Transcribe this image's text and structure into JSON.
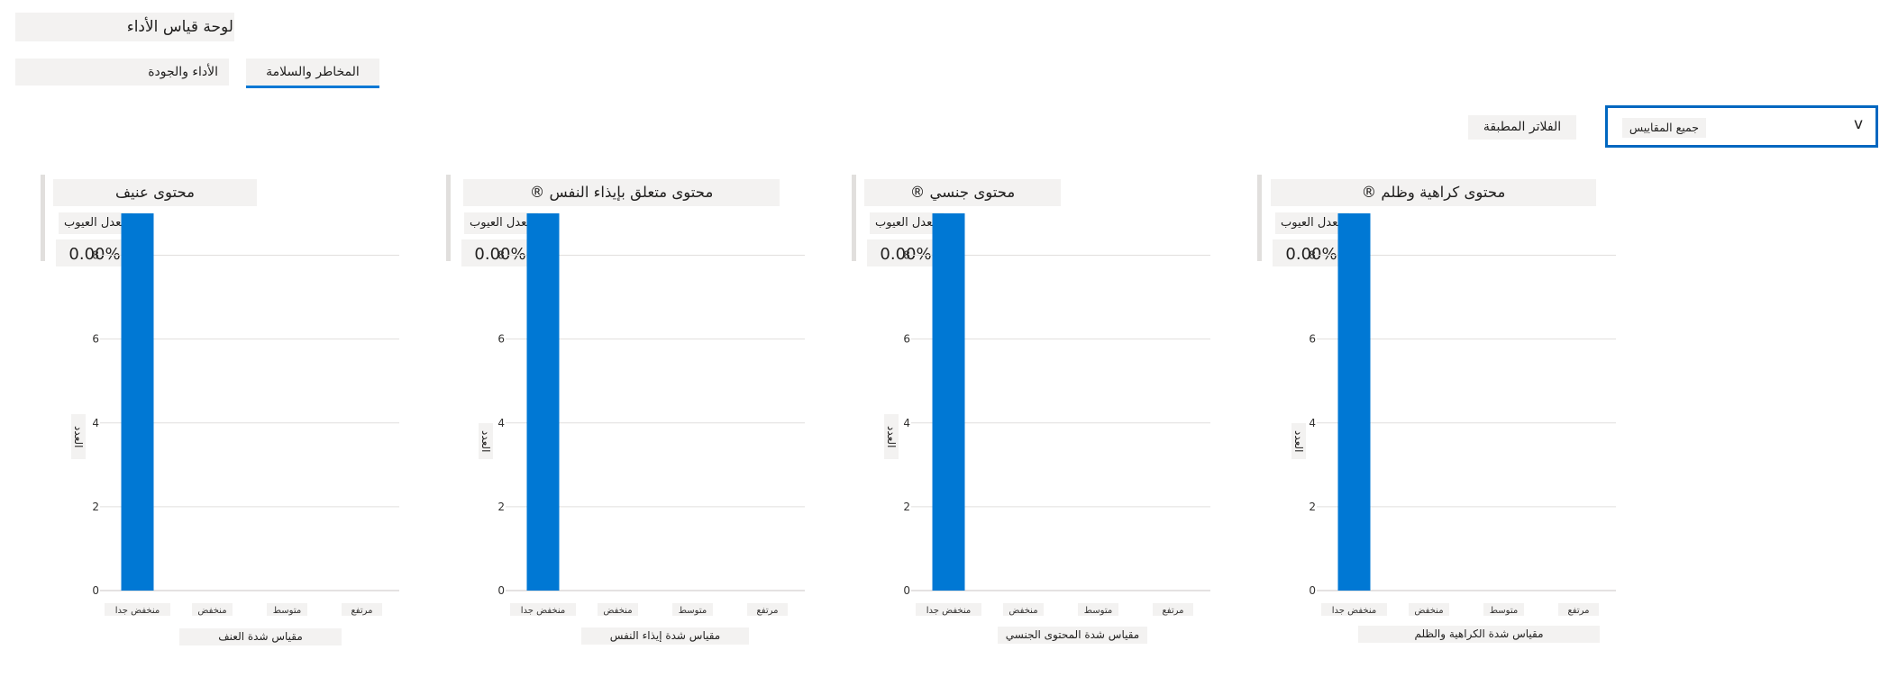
{
  "page": {
    "title": "لوحة قياس الأداء"
  },
  "tabs": [
    {
      "label": "الأداء والجودة",
      "selected": false
    },
    {
      "label": "المخاطر والسلامة",
      "selected": true
    }
  ],
  "filters": {
    "label": "الفلاتر المطبقة",
    "selected_chip": "جميع المقاييس",
    "caret": "v"
  },
  "colors": {
    "accent": "#0078d4",
    "bar": "#0078d4",
    "chip_bg": "#f3f2f1"
  },
  "panels": [
    {
      "title": "محتوى عنيف",
      "metric_label": "معدل العيوب",
      "metric_value": "0.00%",
      "ylabel": "العدد",
      "xlabel": "مقياس شدة العنف",
      "ticks": [
        "0",
        "2",
        "4",
        "6",
        "8"
      ],
      "categories": [
        "منخفض جدا",
        "منخفض",
        "متوسط",
        "مرتفع"
      ],
      "values": [
        9,
        0,
        0,
        0
      ]
    },
    {
      "title": "محتوى متعلق بإيذاء النفس ®",
      "metric_label": "معدل العيوب",
      "metric_value": "0.00%",
      "ylabel": "العدد",
      "xlabel": "مقياس شدة إيذاء النفس",
      "ticks": [
        "0",
        "2",
        "4",
        "6",
        "8"
      ],
      "categories": [
        "منخفض جدا",
        "منخفض",
        "متوسط",
        "مرتفع"
      ],
      "values": [
        9,
        0,
        0,
        0
      ]
    },
    {
      "title": "محتوى جنسي ®",
      "metric_label": "معدل العيوب",
      "metric_value": "0.00%",
      "ylabel": "العدد",
      "xlabel": "مقياس شدة المحتوى الجنسي",
      "ticks": [
        "0",
        "2",
        "4",
        "6",
        "8"
      ],
      "categories": [
        "منخفض جدا",
        "منخفض",
        "متوسط",
        "مرتفع"
      ],
      "values": [
        9,
        0,
        0,
        0
      ]
    },
    {
      "title": "محتوى كراهية وظلم ®",
      "metric_label": "معدل العيوب",
      "metric_value": "0.00%",
      "ylabel": "العدد",
      "xlabel": "مقياس شدة الكراهية والظلم",
      "ticks": [
        "0",
        "2",
        "4",
        "6",
        "8"
      ],
      "categories": [
        "منخفض جدا",
        "منخفض",
        "متوسط",
        "مرتفع"
      ],
      "values": [
        9,
        0,
        0,
        0
      ]
    }
  ],
  "chart_data": [
    {
      "type": "bar",
      "title": "محتوى عنيف",
      "xlabel": "مقياس شدة العنف",
      "ylabel": "العدد",
      "categories": [
        "منخفض جدا",
        "منخفض",
        "متوسط",
        "مرتفع"
      ],
      "values": [
        9,
        0,
        0,
        0
      ],
      "ylim": [
        0,
        9
      ],
      "grid": true
    },
    {
      "type": "bar",
      "title": "محتوى متعلق بإيذاء النفس ®",
      "xlabel": "مقياس شدة إيذاء النفس",
      "ylabel": "العدد",
      "categories": [
        "منخفض جدا",
        "منخفض",
        "متوسط",
        "مرتفع"
      ],
      "values": [
        9,
        0,
        0,
        0
      ],
      "ylim": [
        0,
        9
      ],
      "grid": true
    },
    {
      "type": "bar",
      "title": "محتوى جنسي ®",
      "xlabel": "مقياس شدة المحتوى الجنسي",
      "ylabel": "العدد",
      "categories": [
        "منخفض جدا",
        "منخفض",
        "متوسط",
        "مرتفع"
      ],
      "values": [
        9,
        0,
        0,
        0
      ],
      "ylim": [
        0,
        9
      ],
      "grid": true
    },
    {
      "type": "bar",
      "title": "محتوى كراهية وظلم ®",
      "xlabel": "مقياس شدة الكراهية والظلم",
      "ylabel": "العدد",
      "categories": [
        "منخفض جدا",
        "منخفض",
        "متوسط",
        "مرتفع"
      ],
      "values": [
        9,
        0,
        0,
        0
      ],
      "ylim": [
        0,
        9
      ],
      "grid": true
    }
  ]
}
